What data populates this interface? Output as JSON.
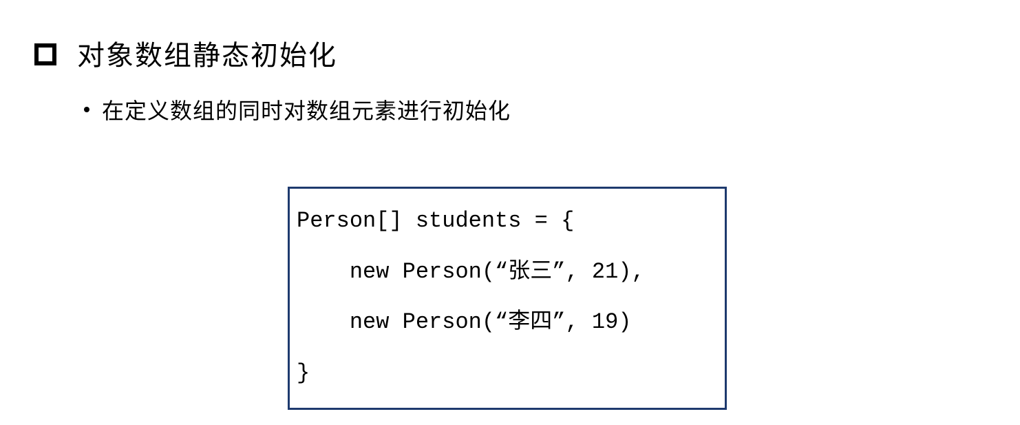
{
  "heading": "对象数组静态初始化",
  "subheading": "在定义数组的同时对数组元素进行初始化",
  "code": {
    "line1": "Person[] students = {",
    "line2": "    new Person(“张三”, 21),",
    "line3": "    new Person(“李四”, 19)",
    "line4": "}"
  }
}
